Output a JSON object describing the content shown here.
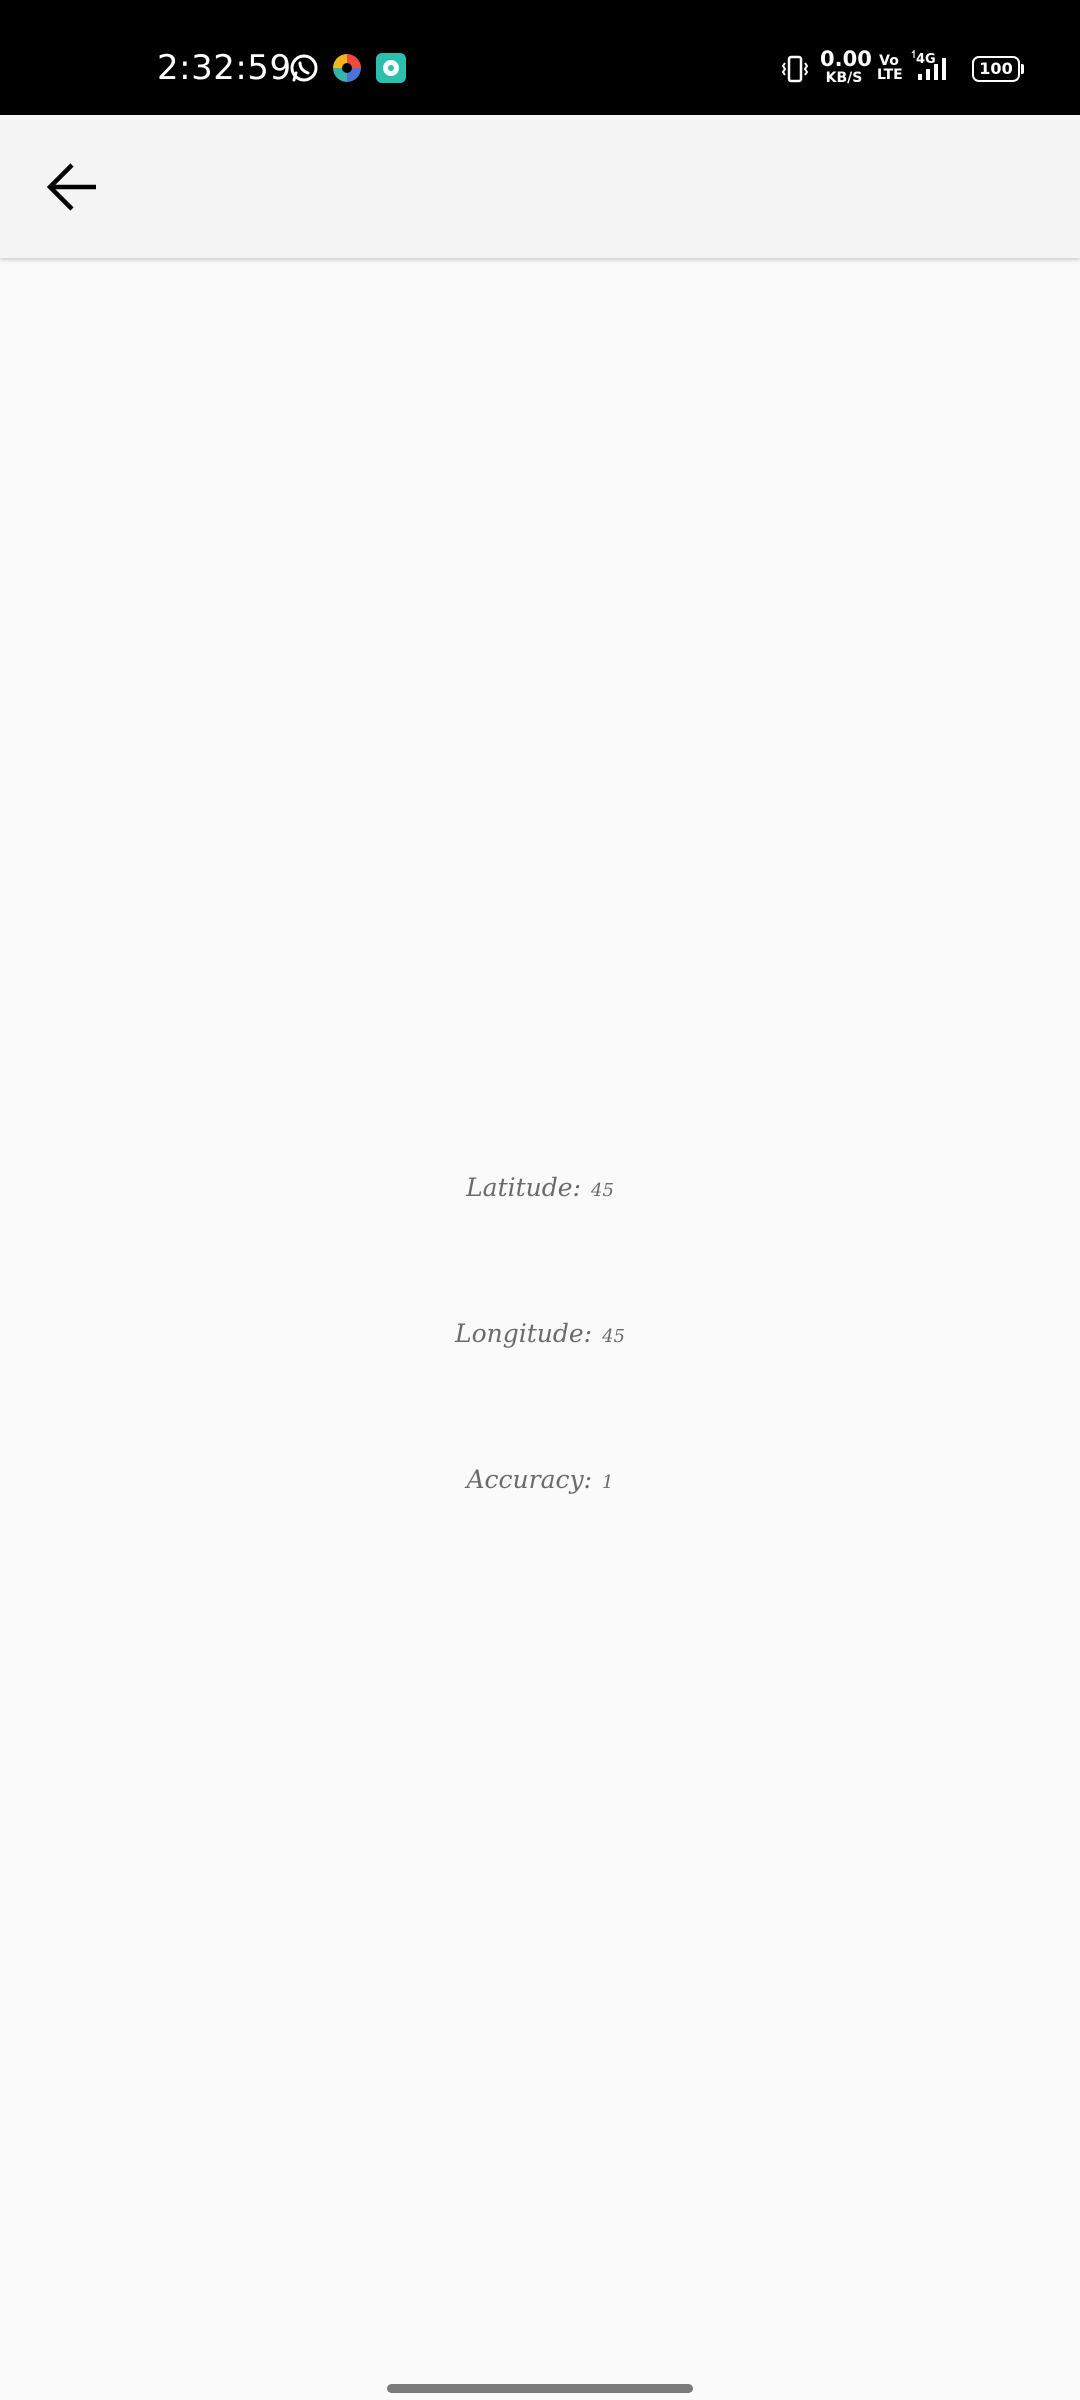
{
  "status_bar": {
    "time": "2:32:59",
    "network_speed_value": "0.00",
    "network_speed_unit": "KB/S",
    "volte_top": "Vo",
    "volte_bottom": "LTE",
    "network_type": "4G",
    "battery": "100",
    "notification_icons": [
      "whatsapp-icon",
      "colorful-app-icon",
      "teal-chat-app-icon"
    ]
  },
  "app_bar": {
    "back_icon": "arrow-left-icon"
  },
  "location": {
    "latitude_label": "Latitude:",
    "latitude_value": "45",
    "longitude_label": "Longitude:",
    "longitude_value": "45",
    "accuracy_label": "Accuracy:",
    "accuracy_value": "1"
  },
  "colors": {
    "status_bar_bg": "#000000",
    "app_bar_bg": "#f4f4f4",
    "page_bg": "#fafafa",
    "text_gray": "#6b6b6b",
    "gesture_bar": "#7a7a7a"
  }
}
